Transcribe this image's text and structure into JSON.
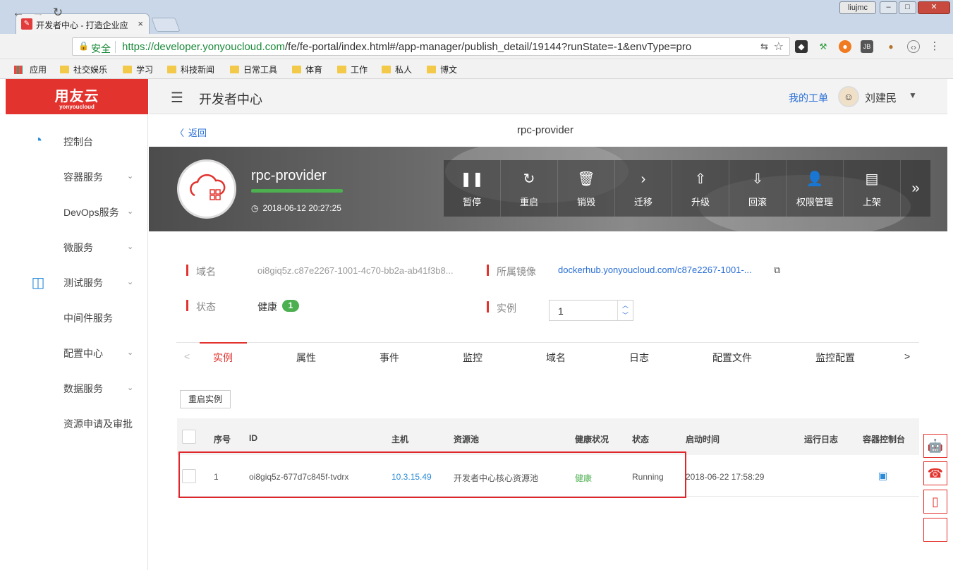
{
  "browser": {
    "tab_title": "开发者中心 - 打造企业应",
    "tab_close": "×",
    "profile_name": "liujmc",
    "secure_label": "安全",
    "url_host": "https://developer.yonyoucloud.com",
    "url_path": "/fe/fe-portal/index.html#/app-manager/publish_detail/19144?runState=-1&envType=pro",
    "bookmarks": [
      "应用",
      "社交娱乐",
      "学习",
      "科技新闻",
      "日常工具",
      "体育",
      "工作",
      "私人",
      "博文"
    ]
  },
  "logo": {
    "main": "用友云",
    "sub": "yonyoucloud"
  },
  "sidebar": {
    "items": [
      {
        "label": "控制台"
      },
      {
        "label": "容器服务"
      },
      {
        "label": "DevOps服务"
      },
      {
        "label": "微服务"
      },
      {
        "label": "测试服务"
      },
      {
        "label": "中间件服务"
      },
      {
        "label": "配置中心"
      },
      {
        "label": "数据服务"
      },
      {
        "label": "资源申请及审批"
      }
    ]
  },
  "header": {
    "title": "开发者中心",
    "my_orders": "我的工单",
    "username": "刘建民"
  },
  "page": {
    "back": "返回",
    "title": "rpc-provider"
  },
  "app": {
    "name": "rpc-provider",
    "created": "2018-06-12 20:27:25",
    "health_color": "#4caf50"
  },
  "toolbar": {
    "buttons": [
      {
        "label": "暂停",
        "icon": "pause-icon"
      },
      {
        "label": "重启",
        "icon": "restart-icon"
      },
      {
        "label": "销毁",
        "icon": "trash-icon"
      },
      {
        "label": "迁移",
        "icon": "chevron-right-icon"
      },
      {
        "label": "升级",
        "icon": "upgrade-icon"
      },
      {
        "label": "回滚",
        "icon": "rollback-icon"
      },
      {
        "label": "权限管理",
        "icon": "user-gear-icon"
      },
      {
        "label": "上架",
        "icon": "store-icon"
      }
    ]
  },
  "details": {
    "domain_label": "域名",
    "domain_value": "oi8giq5z.c87e2267-1001-4c70-bb2a-ab41f3b8...",
    "image_label": "所属镜像",
    "image_value": "dockerhub.yonyoucloud.com/c87e2267-1001-...",
    "status_label": "状态",
    "status_value": "健康",
    "status_count": "1",
    "instances_label": "实例",
    "instances_value": "1"
  },
  "tabs": {
    "prev": "<",
    "next": ">",
    "items": [
      "实例",
      "属性",
      "事件",
      "监控",
      "域名",
      "日志",
      "配置文件",
      "监控配置"
    ],
    "active": "实例"
  },
  "actions": {
    "restart_instance": "重启实例"
  },
  "table": {
    "headers": [
      "序号",
      "ID",
      "主机",
      "资源池",
      "健康状况",
      "状态",
      "启动时间",
      "运行日志",
      "容器控制台"
    ],
    "rows": [
      {
        "index": "1",
        "id": "oi8giq5z-677d7c845f-tvdrx",
        "host": "10.3.15.49",
        "pool": "开发者中心核心资源池",
        "health": "健康",
        "status": "Running",
        "start": "2018-06-22 17:58:29"
      }
    ]
  },
  "colors": {
    "brand": "#e2332e",
    "link": "#2a6fd6",
    "healthy": "#4caf50"
  }
}
